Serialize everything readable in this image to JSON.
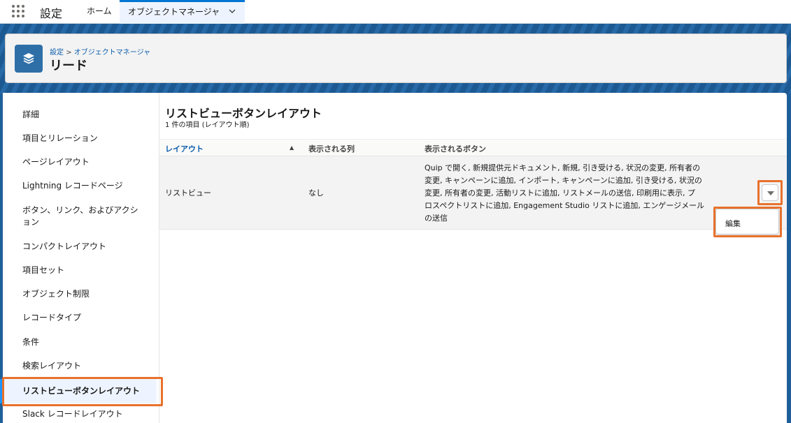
{
  "nav": {
    "app_name": "設定",
    "tabs": [
      {
        "label": "ホーム"
      },
      {
        "label": "オブジェクトマネージャ"
      }
    ]
  },
  "header": {
    "breadcrumb_root": "設定",
    "breadcrumb_sep": ">",
    "breadcrumb_current": "オブジェクトマネージャ",
    "title": "リード",
    "icon": "layers-icon"
  },
  "sidebar": {
    "items": [
      {
        "label": "詳細"
      },
      {
        "label": "項目とリレーション"
      },
      {
        "label": "ページレイアウト"
      },
      {
        "label": "Lightning レコードページ"
      },
      {
        "label": "ボタン、リンク、およびアクシ"
      },
      {
        "label": "ョン"
      },
      {
        "label": "コンパクトレイアウト"
      },
      {
        "label": "項目セット"
      },
      {
        "label": "オブジェクト制限"
      },
      {
        "label": "レコードタイプ"
      },
      {
        "label": "条件"
      },
      {
        "label": "検索レイアウト"
      },
      {
        "label": "リストビューボタンレイアウト"
      },
      {
        "label": "Slack レコードレイアウト"
      }
    ],
    "active_index": 12
  },
  "content": {
    "title": "リストビューボタンレイアウト",
    "subtitle": "1 件の項目 (レイアウト順)",
    "columns": [
      "レイアウト",
      "表示される列",
      "表示されるボタン"
    ],
    "sort_indicator": "▲",
    "rows": [
      {
        "layout": "リストビュー",
        "columns_shown": "なし",
        "buttons_lines": [
          "Quip で開く, 新規提供元ドキュメント, 新規, 引き受ける, 状況の変更, 所有者の",
          "変更, キャンペーンに追加, インポート, キャンペーンに追加, 引き受ける, 状況の",
          "変更, 所有者の変更, 活動リストに追加, リストメールの送信, 印刷用に表示, プ",
          "ロスペクトリストに追加, Engagement Studio リストに追加, エンゲージメール",
          "の送信"
        ]
      }
    ],
    "row_menu_icon": "chevron-down-icon",
    "dropdown": {
      "edit_label": "編集"
    }
  },
  "colors": {
    "accent": "#0176d3",
    "highlight": "#e8712c",
    "band": "#1f5f99"
  }
}
